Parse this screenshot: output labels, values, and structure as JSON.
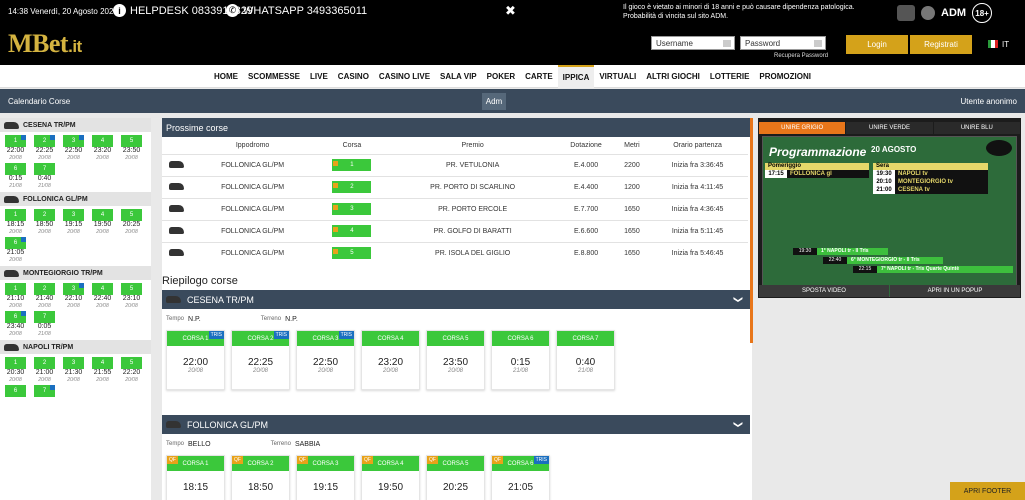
{
  "topbar": {
    "datetime": "14:38 Venerdì, 20 Agosto 2021",
    "helpdesk": "HELPDESK 0833913829",
    "whatsapp": "WHATSAPP 3493365011",
    "close": "✖",
    "warning_line1": "Il gioco è vietato ai minori di 18 anni e può causare dipendenza patologica.",
    "warning_line2": "Probabilità di vincita sul sito ADM.",
    "adm": "ADM",
    "age": "18+"
  },
  "header": {
    "logo_main": "MBet",
    "logo_ext": ".it",
    "username_placeholder": "Username",
    "password_placeholder": "Password",
    "recupera": "Recupera Password",
    "login": "Login",
    "register": "Registrati",
    "lang": "IT"
  },
  "nav": {
    "items": [
      "HOME",
      "SCOMMESSE",
      "LIVE",
      "CASINO",
      "CASINO LIVE",
      "SALA VIP",
      "POKER",
      "CARTE",
      "IPPICA",
      "VIRTUALI",
      "ALTRI GIOCHI",
      "LOTTERIE",
      "PROMOZIONI"
    ],
    "active": "IPPICA"
  },
  "subbar": {
    "left": "Calendario Corse",
    "center": "Adm",
    "right": "Utente anonimo"
  },
  "left": {
    "sections": [
      {
        "name": "CESENA TR/PM",
        "races": [
          {
            "n": "1",
            "t": "22:00",
            "d": "20/08",
            "tag": true
          },
          {
            "n": "2",
            "t": "22:25",
            "d": "20/08",
            "tag": true
          },
          {
            "n": "3",
            "t": "22:50",
            "d": "20/08",
            "tag": true
          },
          {
            "n": "4",
            "t": "23:20",
            "d": "20/08",
            "tag": false
          },
          {
            "n": "5",
            "t": "23:50",
            "d": "20/08",
            "tag": false
          },
          {
            "n": "6",
            "t": "0:15",
            "d": "21/08",
            "tag": false
          },
          {
            "n": "7",
            "t": "0:40",
            "d": "21/08",
            "tag": false
          }
        ]
      },
      {
        "name": "FOLLONICA GL/PM",
        "races": [
          {
            "n": "1",
            "t": "18:15",
            "d": "20/08",
            "tag": false
          },
          {
            "n": "2",
            "t": "18:50",
            "d": "20/08",
            "tag": false
          },
          {
            "n": "3",
            "t": "19:15",
            "d": "20/08",
            "tag": false
          },
          {
            "n": "4",
            "t": "19:50",
            "d": "20/08",
            "tag": false
          },
          {
            "n": "5",
            "t": "20:25",
            "d": "20/08",
            "tag": false
          },
          {
            "n": "6",
            "t": "21:05",
            "d": "20/08",
            "tag": true
          }
        ]
      },
      {
        "name": "MONTEGIORGIO TR/PM",
        "races": [
          {
            "n": "1",
            "t": "21:10",
            "d": "20/08",
            "tag": false
          },
          {
            "n": "2",
            "t": "21:40",
            "d": "20/08",
            "tag": false
          },
          {
            "n": "3",
            "t": "22:10",
            "d": "20/08",
            "tag": true
          },
          {
            "n": "4",
            "t": "22:40",
            "d": "20/08",
            "tag": false
          },
          {
            "n": "5",
            "t": "23:10",
            "d": "20/08",
            "tag": false
          },
          {
            "n": "6",
            "t": "23:40",
            "d": "20/08",
            "tag": true
          },
          {
            "n": "7",
            "t": "0:05",
            "d": "21/08",
            "tag": false
          }
        ]
      },
      {
        "name": "NAPOLI TR/PM",
        "races": [
          {
            "n": "1",
            "t": "20:30",
            "d": "20/08",
            "tag": false
          },
          {
            "n": "2",
            "t": "21:00",
            "d": "20/08",
            "tag": false
          },
          {
            "n": "3",
            "t": "21:30",
            "d": "20/08",
            "tag": false
          },
          {
            "n": "4",
            "t": "21:55",
            "d": "20/08",
            "tag": false
          },
          {
            "n": "5",
            "t": "22:20",
            "d": "20/08",
            "tag": false
          },
          {
            "n": "6",
            "t": "",
            "d": "",
            "tag": false
          },
          {
            "n": "7",
            "t": "",
            "d": "",
            "tag": true
          }
        ]
      }
    ]
  },
  "prossime": {
    "title": "Prossime corse",
    "headers": [
      "Ippodromo",
      "Corsa",
      "Premio",
      "Dotazione",
      "Metri",
      "Orario partenza"
    ],
    "rows": [
      {
        "ipp": "FOLLONICA GL/PM",
        "corsa": "1",
        "premio": "PR. VETULONIA",
        "dot": "E.4.000",
        "metri": "2200",
        "orario": "Inizia fra 3:36:45"
      },
      {
        "ipp": "FOLLONICA GL/PM",
        "corsa": "2",
        "premio": "PR. PORTO DI SCARLINO",
        "dot": "E.4.400",
        "metri": "1200",
        "orario": "Inizia fra 4:11:45"
      },
      {
        "ipp": "FOLLONICA GL/PM",
        "corsa": "3",
        "premio": "PR. PORTO ERCOLE",
        "dot": "E.7.700",
        "metri": "1650",
        "orario": "Inizia fra 4:36:45"
      },
      {
        "ipp": "FOLLONICA GL/PM",
        "corsa": "4",
        "premio": "PR. GOLFO DI BARATTI",
        "dot": "E.6.600",
        "metri": "1650",
        "orario": "Inizia fra 5:11:45"
      },
      {
        "ipp": "FOLLONICA GL/PM",
        "corsa": "5",
        "premio": "PR. ISOLA DEL GIGLIO",
        "dot": "E.8.800",
        "metri": "1650",
        "orario": "Inizia fra 5:46:45"
      }
    ]
  },
  "riepilogo": {
    "title": "Riepilogo corse",
    "meetings": [
      {
        "name": "CESENA TR/PM",
        "tempo_label": "Tempo",
        "tempo": "N.P.",
        "terreno_label": "Terreno",
        "terreno": "N.P.",
        "cards": [
          {
            "label": "CORSA 1",
            "time": "22:00",
            "date": "20/08",
            "tris": true,
            "qf": false
          },
          {
            "label": "CORSA 2",
            "time": "22:25",
            "date": "20/08",
            "tris": true,
            "qf": false
          },
          {
            "label": "CORSA 3",
            "time": "22:50",
            "date": "20/08",
            "tris": true,
            "qf": false
          },
          {
            "label": "CORSA 4",
            "time": "23:20",
            "date": "20/08",
            "tris": false,
            "qf": false
          },
          {
            "label": "CORSA 5",
            "time": "23:50",
            "date": "20/08",
            "tris": false,
            "qf": false
          },
          {
            "label": "CORSA 6",
            "time": "0:15",
            "date": "21/08",
            "tris": false,
            "qf": false
          },
          {
            "label": "CORSA 7",
            "time": "0:40",
            "date": "21/08",
            "tris": false,
            "qf": false
          }
        ]
      },
      {
        "name": "FOLLONICA GL/PM",
        "tempo_label": "Tempo",
        "tempo": "BELLO",
        "terreno_label": "Terreno",
        "terreno": "SABBIA",
        "cards": [
          {
            "label": "CORSA 1",
            "time": "18:15",
            "date": "",
            "tris": false,
            "qf": true
          },
          {
            "label": "CORSA 2",
            "time": "18:50",
            "date": "",
            "tris": false,
            "qf": true
          },
          {
            "label": "CORSA 3",
            "time": "19:15",
            "date": "",
            "tris": false,
            "qf": true
          },
          {
            "label": "CORSA 4",
            "time": "19:50",
            "date": "",
            "tris": false,
            "qf": true
          },
          {
            "label": "CORSA 5",
            "time": "20:25",
            "date": "",
            "tris": false,
            "qf": true
          },
          {
            "label": "CORSA 6",
            "time": "21:05",
            "date": "",
            "tris": true,
            "qf": true
          }
        ]
      }
    ],
    "tris_label": "TRIS",
    "qf_label": "QF"
  },
  "tv": {
    "tabs": [
      "UNIRE GRIGIO",
      "UNIRE VERDE",
      "UNIRE BLU"
    ],
    "active_tab": "UNIRE GRIGIO",
    "title": "Programmazione",
    "date": "20 AGOSTO",
    "pom_label": "Pomeriggio",
    "pom": [
      {
        "t": "17:15",
        "n": "FOLLONICA gl"
      }
    ],
    "sera_label": "Sera",
    "sera": [
      {
        "t": "19:30",
        "n": "NAPOLI tv"
      },
      {
        "t": "20:10",
        "n": "MONTEGIORGIO tv"
      },
      {
        "t": "21:00",
        "n": "CESENA tv"
      }
    ],
    "lines": [
      {
        "t": "19:30",
        "n": "1° NAPOLI tr - Il Tris"
      },
      {
        "t": "22:40",
        "n": "6° MONTEGIORGIO tr - Il Tris"
      },
      {
        "t": "22:15",
        "n": "7° NAPOLI tr - Tris Quarte Quintè"
      }
    ],
    "footer": [
      "SPOSTA VIDEO",
      "APRI IN UN POPUP"
    ]
  },
  "footer_btn": "APRI FOOTER",
  "colors": {
    "accent": "#d4a21a",
    "green": "#3bc83b",
    "navy": "#3a4a5c",
    "orange": "#e8761a"
  }
}
